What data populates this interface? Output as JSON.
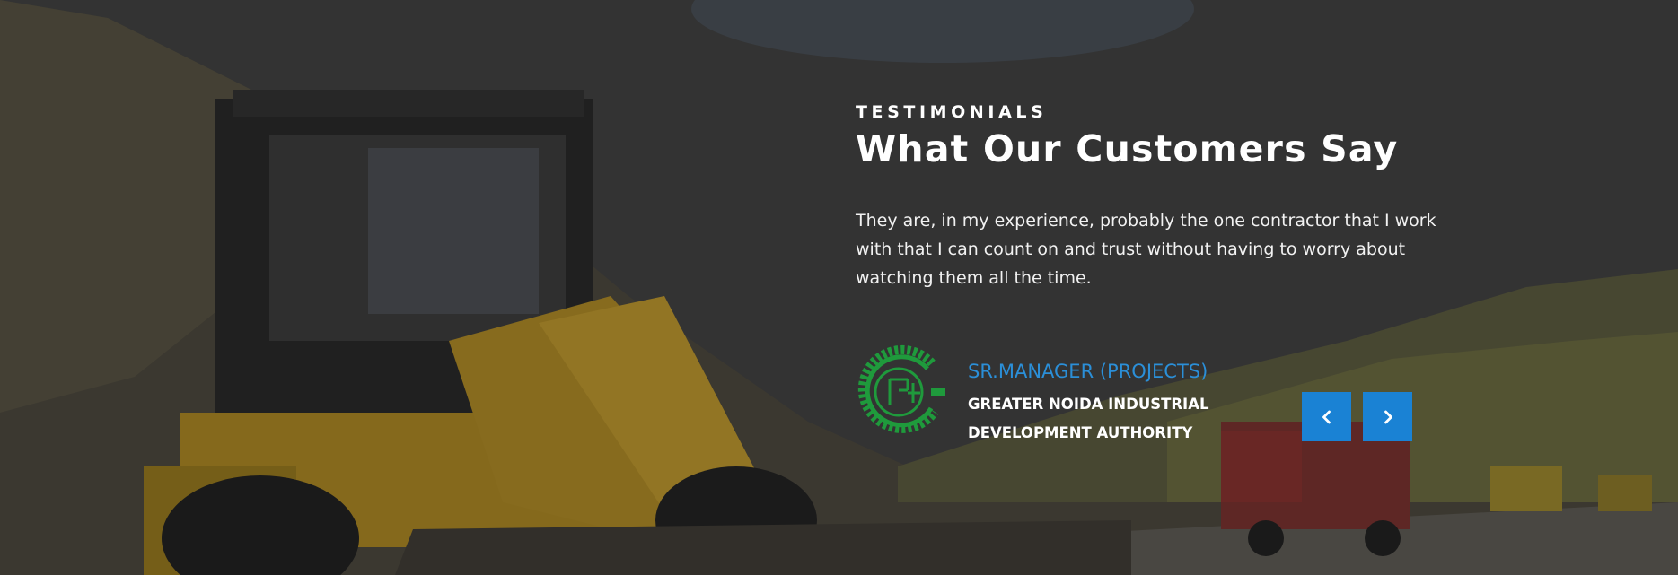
{
  "testimonials": {
    "eyebrow": "TESTIMONIALS",
    "heading": "What Our Customers Say",
    "quote": "They are, in my experience, probably the one contractor that I work with that I can count on and trust without having to worry about watching them all the time.",
    "author": {
      "role": "SR.MANAGER (PROJECTS)",
      "organization": "GREATER NOIDA INDUSTRIAL DEVELOPMENT AUTHORITY",
      "logo": "gnida-seal-logo"
    },
    "controls": {
      "prev_icon": "chevron-left-icon",
      "next_icon": "chevron-right-icon"
    }
  },
  "colors": {
    "accent": "#1a82d4",
    "role_text": "#2b8fd8",
    "logo_green": "#1f9a3c"
  }
}
